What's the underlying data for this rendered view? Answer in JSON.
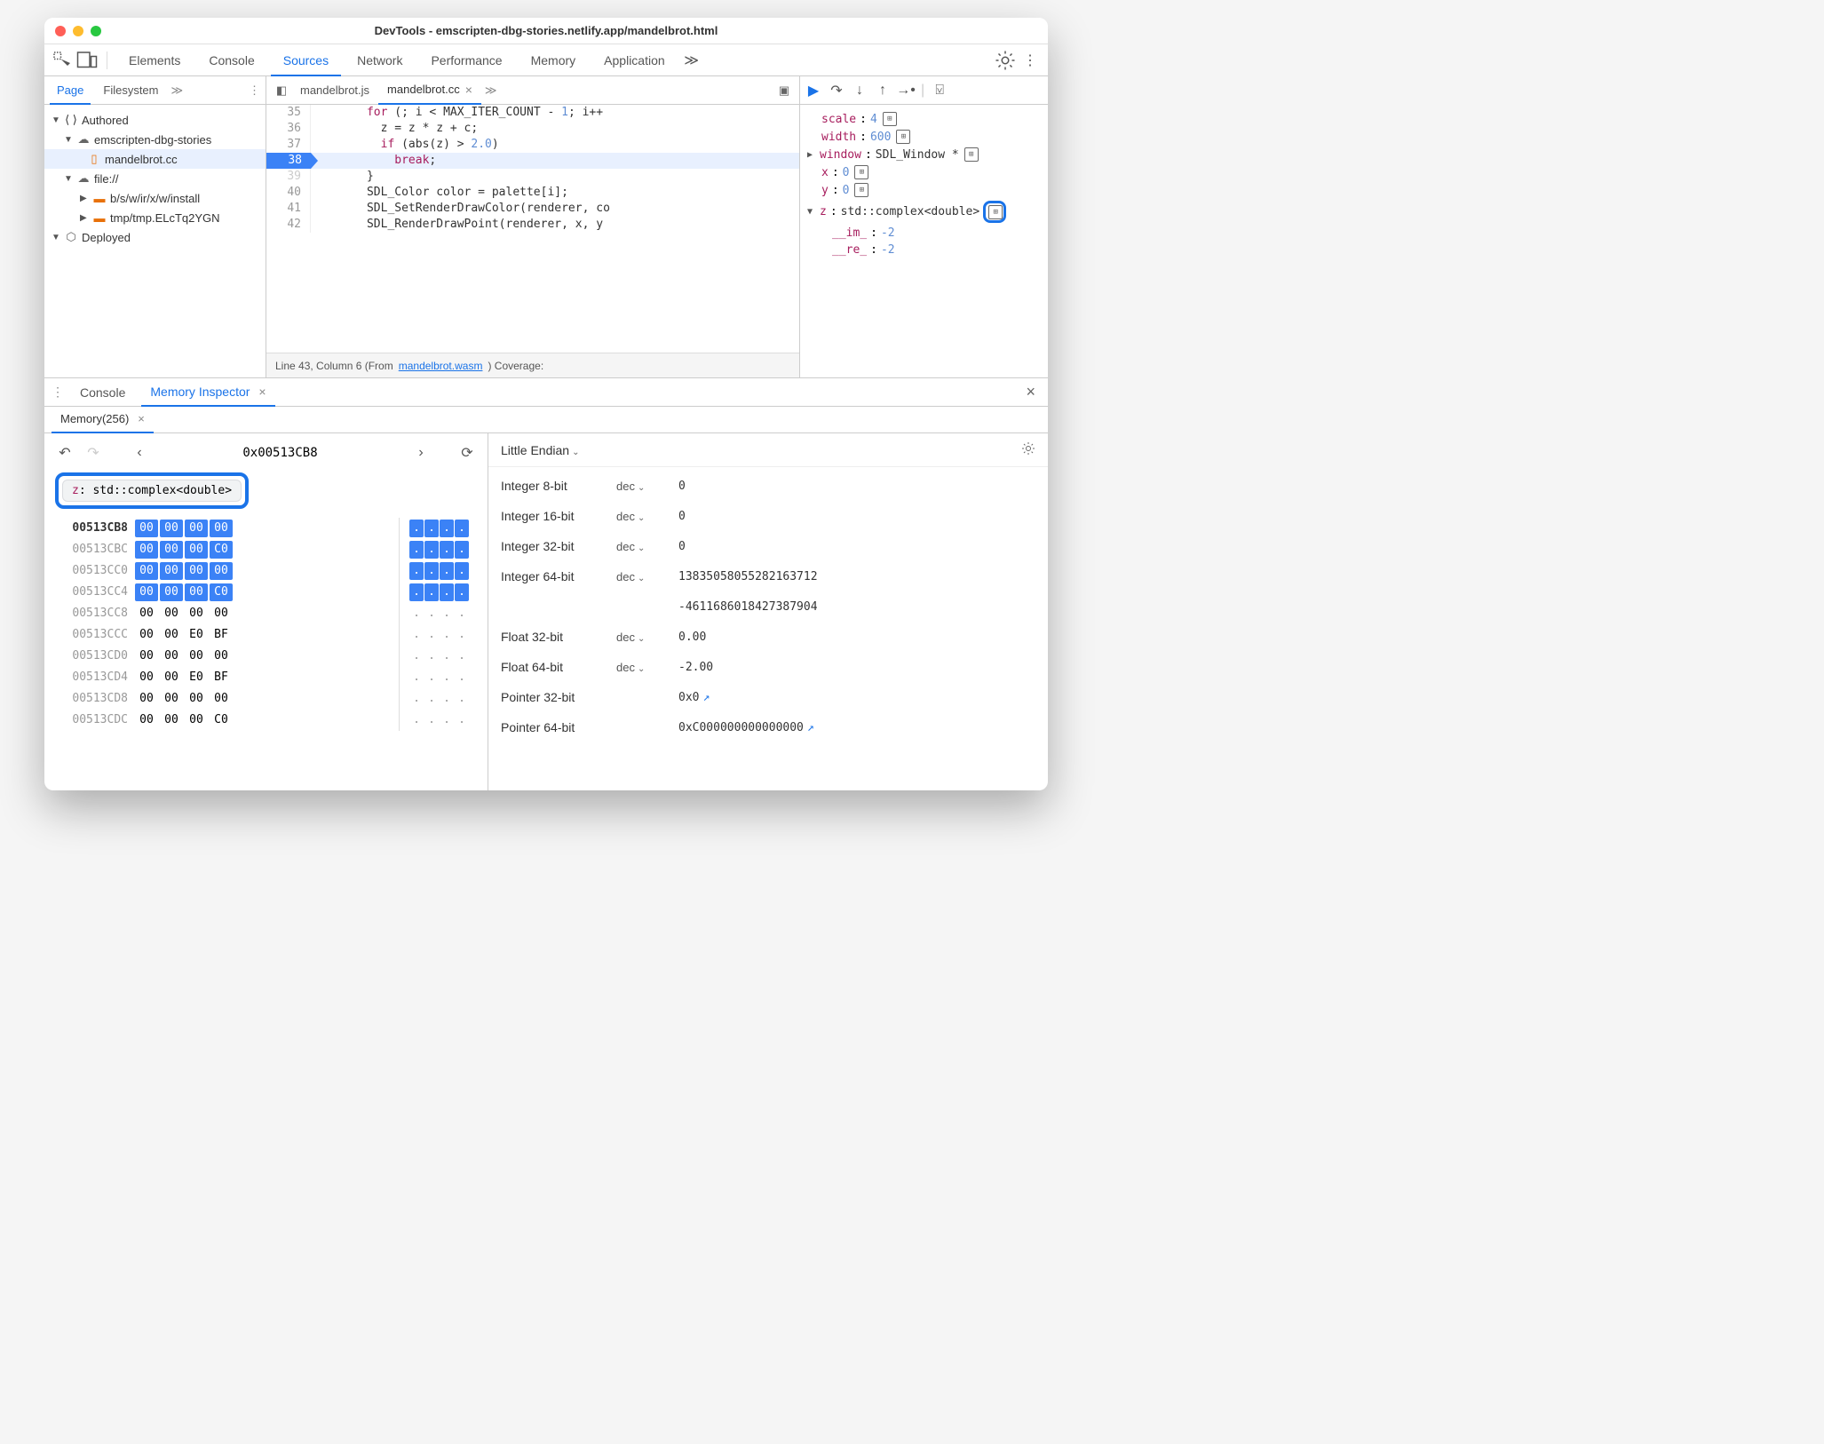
{
  "title": "DevTools - emscripten-dbg-stories.netlify.app/mandelbrot.html",
  "tabs": [
    "Elements",
    "Console",
    "Sources",
    "Network",
    "Performance",
    "Memory",
    "Application"
  ],
  "activeTab": "Sources",
  "sidebar": {
    "tabs": {
      "page": "Page",
      "fs": "Filesystem"
    },
    "tree": {
      "authored": "Authored",
      "origin": "emscripten-dbg-stories",
      "file1": "mandelbrot.cc",
      "fileorigin": "file://",
      "folder1": "b/s/w/ir/x/w/install",
      "folder2": "tmp/tmp.ELcTq2YGN",
      "deployed": "Deployed"
    }
  },
  "editor": {
    "tab1": "mandelbrot.js",
    "tab2": "mandelbrot.cc",
    "lines": {
      "35": "      for (; i < MAX_ITER_COUNT - 1; i++",
      "36": "        z = z * z + c;",
      "37": "        if (abs(z) > 2.0)",
      "38": "          break;",
      "39": "      }",
      "40": "      SDL_Color color = palette[i];",
      "41": "      SDL_SetRenderDrawColor(renderer, co",
      "42": "      SDL_RenderDrawPoint(renderer, x, y"
    },
    "status": {
      "pre": "Line 43, Column 6  (From ",
      "link": "mandelbrot.wasm",
      "post": ")  Coverage:"
    }
  },
  "scope": {
    "scale": {
      "n": "scale",
      "v": "4"
    },
    "width": {
      "n": "width",
      "v": "600"
    },
    "window": {
      "n": "window",
      "v": "SDL_Window *"
    },
    "x": {
      "n": "x",
      "v": "0"
    },
    "y": {
      "n": "y",
      "v": "0"
    },
    "z": {
      "n": "z",
      "v": "std::complex<double>"
    },
    "im": {
      "n": "__im_",
      "v": "-2"
    },
    "re": {
      "n": "__re_",
      "v": "-2"
    }
  },
  "drawer": {
    "console": "Console",
    "memInsp": "Memory Inspector",
    "memTab": "Memory(256)",
    "address": "0x00513CB8",
    "chip": {
      "name": "z",
      "type": "std::complex<double>"
    },
    "rows": [
      {
        "addr": "00513CB8",
        "bytes": [
          "00",
          "00",
          "00",
          "00"
        ],
        "hl": true,
        "cur": true
      },
      {
        "addr": "00513CBC",
        "bytes": [
          "00",
          "00",
          "00",
          "C0"
        ],
        "hl": true
      },
      {
        "addr": "00513CC0",
        "bytes": [
          "00",
          "00",
          "00",
          "00"
        ],
        "hl": true
      },
      {
        "addr": "00513CC4",
        "bytes": [
          "00",
          "00",
          "00",
          "C0"
        ],
        "hl": true
      },
      {
        "addr": "00513CC8",
        "bytes": [
          "00",
          "00",
          "00",
          "00"
        ]
      },
      {
        "addr": "00513CCC",
        "bytes": [
          "00",
          "00",
          "E0",
          "BF"
        ]
      },
      {
        "addr": "00513CD0",
        "bytes": [
          "00",
          "00",
          "00",
          "00"
        ]
      },
      {
        "addr": "00513CD4",
        "bytes": [
          "00",
          "00",
          "E0",
          "BF"
        ]
      },
      {
        "addr": "00513CD8",
        "bytes": [
          "00",
          "00",
          "00",
          "00"
        ]
      },
      {
        "addr": "00513CDC",
        "bytes": [
          "00",
          "00",
          "00",
          "C0"
        ]
      }
    ],
    "endian": "Little Endian",
    "interp": [
      {
        "label": "Integer 8-bit",
        "fmt": "dec",
        "val": "0"
      },
      {
        "label": "Integer 16-bit",
        "fmt": "dec",
        "val": "0"
      },
      {
        "label": "Integer 32-bit",
        "fmt": "dec",
        "val": "0"
      },
      {
        "label": "Integer 64-bit",
        "fmt": "dec",
        "val": "13835058055282163712"
      },
      {
        "label": "",
        "fmt": "",
        "val": "-4611686018427387904"
      },
      {
        "label": "Float 32-bit",
        "fmt": "dec",
        "val": "0.00"
      },
      {
        "label": "Float 64-bit",
        "fmt": "dec",
        "val": "-2.00"
      },
      {
        "label": "Pointer 32-bit",
        "fmt": "",
        "val": "0x0",
        "link": true
      },
      {
        "label": "Pointer 64-bit",
        "fmt": "",
        "val": "0xC000000000000000",
        "link": true
      }
    ]
  }
}
